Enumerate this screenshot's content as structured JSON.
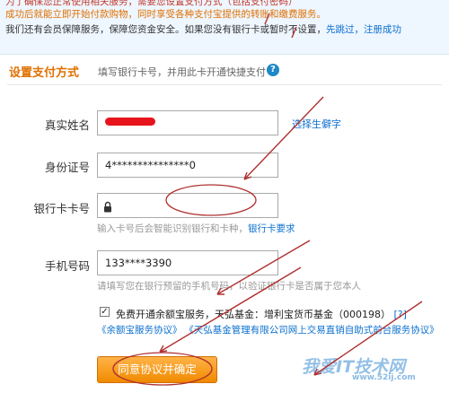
{
  "notice": {
    "line1": "为了确保您正常使用相关服务，需要您设置支付方式（包括支付密码）",
    "line2": "成功后就能立即开始付款购物，同时享受各种支付宝提供的转账和缴费服务。",
    "line3_text": "我们还有会员保障服务，保障您资金安全。如果您没有银行卡或暂时不设置，",
    "line3_skip": "先跳过，注册成功"
  },
  "section": {
    "title": "设置支付方式",
    "subtitle": "填写银行卡号，并用此卡开通快捷支付",
    "help_icon": "question-icon"
  },
  "form": {
    "name_label": "真实姓名",
    "name_link": "选择生僻字",
    "id_label": "身份证号",
    "id_value": "4***************0",
    "card_label": "银行卡卡号",
    "card_hint": "输入卡号后会智能识别银行和卡种，",
    "card_hint_link": "银行卡要求",
    "phone_label": "手机号码",
    "phone_value": "133****3390",
    "phone_hint": "请填写您在银行预留的手机号码，以验证银行卡是否属于您本人"
  },
  "agreement": {
    "checked": true,
    "text": "免费开通余额宝服务，天弘基金：增利宝货币基金（000198）",
    "bracket_link": "[?]",
    "link1": "《余额宝服务协议》",
    "link2": "《天弘基金管理有限公司网上交易直销自助式前台服务协议》"
  },
  "submit_label": "同意协议并确定",
  "watermark": {
    "text": "我爱IT技术网",
    "url": "www.52ij.com"
  },
  "colors": {
    "accent": "#e07000",
    "link": "#0b6fcf",
    "annotation": "#b03030",
    "redaction": "#e8141b"
  }
}
